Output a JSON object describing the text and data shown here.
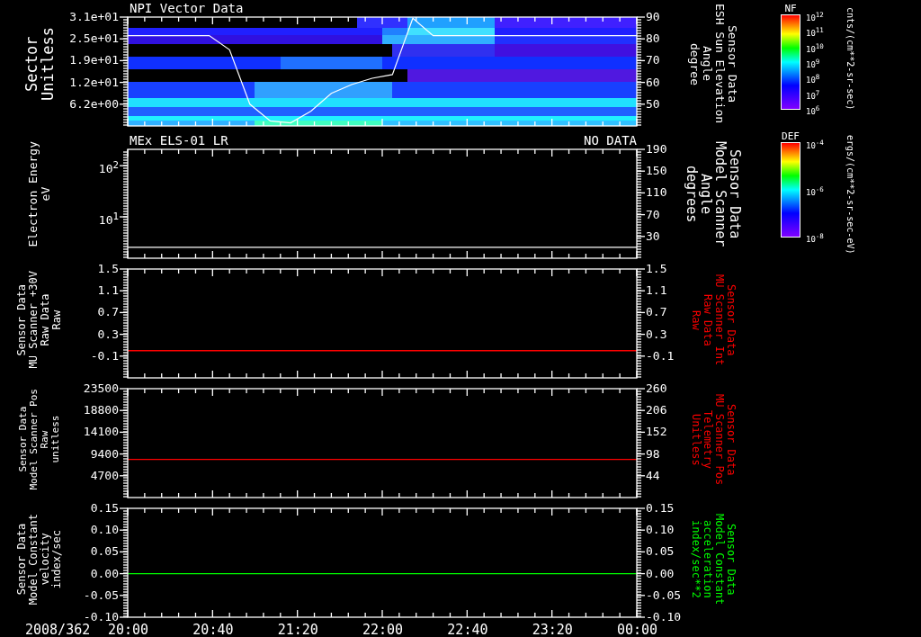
{
  "panels": [
    {
      "title": "NPI Vector Data",
      "left_label": [
        "Sector",
        "Unitless"
      ],
      "left_ticks": [
        "3.1e+01",
        "2.5e+01",
        "1.9e+01",
        "1.2e+01",
        "6.2e+00"
      ],
      "right_label": [
        "Sensor Data",
        "ESH Sun Elevation",
        "Angle",
        "degree"
      ],
      "kind": "spectrogram",
      "chart_data": {
        "type": "line",
        "categories": [
          null,
          null,
          null,
          null,
          null,
          null,
          null,
          null,
          null,
          null,
          null,
          null,
          null,
          null,
          null,
          null,
          null,
          null,
          null,
          null,
          null,
          null,
          null,
          null,
          null,
          null
        ],
        "ylim": [
          40,
          90
        ],
        "yticks": [
          90,
          80,
          70,
          60,
          50
        ],
        "series": [
          {
            "color": "#ffffff",
            "values": [
              81.5,
              81.5,
              81.5,
              81.5,
              81.5,
              75,
              50,
              42.3,
              41.4,
              46.8,
              55,
              59,
              61.9,
              63.6,
              89.5,
              81.5,
              81.5,
              81.5,
              81.5,
              81.5,
              81.5,
              81.5,
              81.5,
              81.5,
              81.5,
              81.5
            ]
          }
        ]
      },
      "colorbar": {
        "title": "NF",
        "ticks": [
          "10$^{12}$",
          "10$^{11}$",
          "10$^{10}$",
          "10$^{9}$",
          "10$^{8}$",
          "10$^{7}$",
          "10$^{6}$"
        ],
        "units": "cnts/(cm**2-sr-sec)"
      }
    },
    {
      "title": "MEx ELS-01 LR",
      "status": "NO DATA",
      "left_label": [
        "Electron Energy",
        "eV"
      ],
      "left_ticks": [
        "10$^{2}$",
        "10$^{1}$"
      ],
      "right_label": [
        "Sensor Data",
        "Model Scanner",
        "Angle",
        "degrees"
      ],
      "right_ticks": [
        "190",
        "150",
        "110",
        "70",
        "30"
      ],
      "kind": "line",
      "color": "#ffffff",
      "colorbar": {
        "title": "DEF",
        "ticks": [
          "10$^{-4}$",
          "10$^{-6}$",
          "10$^{-8}$"
        ],
        "units": "ergs/(cm**2-sr-sec-eV)"
      }
    },
    {
      "left_label": [
        "Sensor Data",
        "MU Scanner +30V",
        "Raw Data",
        "Raw"
      ],
      "left_ticks": [
        "1.5",
        "1.1",
        "0.7",
        "0.3",
        "-0.1"
      ],
      "right_label": [
        "Sensor Data",
        "MU Scanner Int",
        "Raw Data",
        "Raw"
      ],
      "right_ticks": [
        "1.5",
        "1.1",
        "0.7",
        "0.3",
        "-0.1"
      ],
      "kind": "line",
      "color": "#ff0000"
    },
    {
      "left_label": [
        "Sensor Data",
        "Model Scanner Pos",
        "Raw",
        "unitless"
      ],
      "left_ticks": [
        "23500",
        "18800",
        "14100",
        "9400",
        "4700"
      ],
      "right_label": [
        "Sensor Data",
        "MU Scanner Pos",
        "Telemetry",
        "Unitless"
      ],
      "right_ticks": [
        "260",
        "206",
        "152",
        "98",
        "44"
      ],
      "kind": "line",
      "color": "#ff0000"
    },
    {
      "left_label": [
        "Sensor Data",
        "Model Constant",
        "velocity",
        "index/sec"
      ],
      "left_ticks": [
        "0.15",
        "0.10",
        "0.05",
        "0.00",
        "-0.05",
        "-0.10"
      ],
      "right_label": [
        "Sensor Data",
        "Model Constant",
        "acceleration",
        "index/sec**2"
      ],
      "right_ticks": [
        "0.15",
        "0.10",
        "0.05",
        "0.00",
        "-0.05",
        "-0.10"
      ],
      "kind": "line",
      "color": "#00ff00"
    }
  ],
  "time_axis": {
    "date": "2008/362",
    "ticks": [
      "20:00",
      "20:40",
      "21:20",
      "22:00",
      "22:40",
      "23:20",
      "00:00"
    ]
  }
}
